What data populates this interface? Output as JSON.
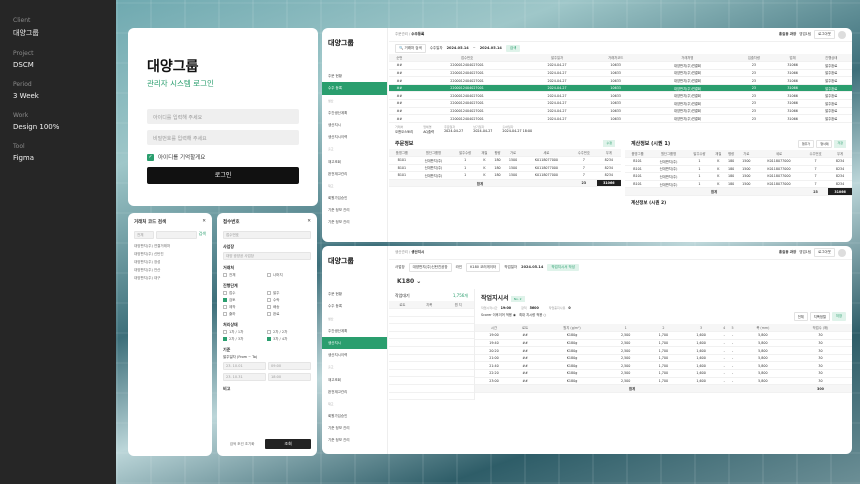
{
  "info": [
    {
      "k": "Client",
      "v": "대양그룹"
    },
    {
      "k": "Project",
      "v": "DSCM"
    },
    {
      "k": "Period",
      "v": "3 Week"
    },
    {
      "k": "Work",
      "v": "Design 100%"
    },
    {
      "k": "Tool",
      "v": "Figma"
    }
  ],
  "login": {
    "brand": "대양그룹",
    "subtitle": "관리자 시스템 로그인",
    "id_placeholder": "아이디를 입력해 주세요",
    "pw_placeholder": "비밀번호를 입력해 주세요",
    "remember": "아이디를 기억할게요",
    "login_button": "로그인"
  },
  "pop1": {
    "title": "거래처 코드 검색",
    "select": "전체",
    "search": "검색",
    "items": [
      "대양판지(주) 연결거래처",
      "대양판지(주) 신탄진",
      "대양판지(주) 장성",
      "대양판지(주) 안산",
      "대양판지(주) 대구"
    ]
  },
  "pop2": {
    "title": "접수번호",
    "f1": "접수번호",
    "lbl_site": "사업장",
    "site": "대양 광양공 사업장",
    "lbl_type": "거래처",
    "type1": "전체",
    "type2": "나머지",
    "lbl_status": "진행단계",
    "status": [
      "접수",
      "발주",
      "검토",
      "수락",
      "제작",
      "배송",
      "출하",
      "완료"
    ],
    "lbl_print": "처리상태",
    "print": [
      "1차 / 1차",
      "2차 / 2차",
      "2차 / 3차",
      "3차 / 4차"
    ],
    "lbl_date": "기준",
    "date_label": "발주일자 (From ~ To)",
    "d1": "23. 10.01",
    "t1": "09:00",
    "d2": "23. 10.31",
    "t2": "18:00",
    "lbl_memo": "비고",
    "reset": "검색 조건 초기화",
    "submit": "조회"
  },
  "app1": {
    "logo": "대양그룹",
    "menu": [
      "",
      "주문 현황",
      "수주 등록",
      "생산",
      "주간생산계획",
      "생산지시",
      "생산지시이력",
      "출고",
      "재고조회",
      "완전재고관리",
      "재고",
      "회원가입승인",
      "기준 정보 관리",
      "기준 정보 관리"
    ],
    "crumb_root": "주문관리",
    "crumb_cur": "수주등록",
    "user": "홍길동 과장",
    "dept": "영업1팀",
    "logout": "로그아웃",
    "filter_ph": "거래처 검색",
    "filter_label": "수주일자",
    "date_from": "2024.05.14",
    "date_to": "2024.05.14",
    "search": "검색",
    "headers": [
      "순번",
      "접수번호",
      "발주일자",
      "거래처코드",
      "거래처명",
      "입출차량",
      "업체",
      "진행상태"
    ],
    "rows": [
      [
        "##",
        "2200012404027001",
        "2024-04-27",
        "10633",
        "대양판지(주)연결회",
        "23",
        "31066",
        "발주완료"
      ],
      [
        "##",
        "2200012404027001",
        "2024-04-27",
        "10633",
        "대양판지(주)연결회",
        "23",
        "31066",
        "발주완료"
      ],
      [
        "##",
        "2200012404027001",
        "2024-04-27",
        "10633",
        "대양판지(주)연결회",
        "23",
        "31066",
        "발주완료"
      ],
      [
        "##",
        "2200012404027001",
        "2024-04-27",
        "10633",
        "대양판지(주)연결회",
        "23",
        "31066",
        "발주완료"
      ],
      [
        "##",
        "2200012404027001",
        "2024-04-27",
        "10633",
        "대양판지(주)연결회",
        "23",
        "31066",
        "발주완료"
      ],
      [
        "##",
        "2200012404027001",
        "2024-04-27",
        "10633",
        "대양판지(주)연결회",
        "23",
        "31066",
        "발주완료"
      ],
      [
        "##",
        "2200012404027001",
        "2024-04-27",
        "10633",
        "대양판지(주)연결회",
        "23",
        "31066",
        "발주완료"
      ],
      [
        "##",
        "2200012404027001",
        "2024-04-27",
        "10633",
        "대양판지(주)연결회",
        "23",
        "31066",
        "발주완료"
      ]
    ],
    "info": [
      {
        "k": "거래처",
        "v": "오앤오스토리"
      },
      {
        "k": "업체명",
        "v": "AQ출력"
      },
      {
        "k": "주문일자",
        "v": "2024-04-27"
      },
      {
        "k": "납기일자",
        "v": "2024-04-27"
      },
      {
        "k": "출하일자",
        "v": "2024-04-27 18:00"
      }
    ],
    "order_title": "주문정보",
    "order_tag": "수정",
    "calc_title": "계산정보 (시퀀 1)",
    "calc_title2": "계산정보 (시퀀 2)",
    "order_headers": [
      "품명그룹",
      "원단그룹명",
      "발주수량",
      "재질",
      "평량",
      "가로",
      "세로",
      "수주번호",
      "무게",
      "수주"
    ],
    "order_rows": [
      [
        "B101",
        "신대판지(주)",
        "1",
        "K",
        "180",
        "1500",
        "K0118077000",
        "7",
        "8234"
      ],
      [
        "B101",
        "신대판지(주)",
        "1",
        "K",
        "180",
        "1500",
        "K0118077000",
        "7",
        "8234"
      ],
      [
        "B101",
        "신대판지(주)",
        "1",
        "K",
        "180",
        "1500",
        "K0118077000",
        "7",
        "8234"
      ]
    ],
    "order_total": [
      "합계",
      "23",
      "31066"
    ],
    "calc_headers": [
      "품명그룹",
      "원단그룹명",
      "발주수량",
      "재질",
      "평량",
      "가로",
      "세로",
      "수주번호",
      "무게",
      "수주"
    ],
    "calc_rows": [
      [
        "B101",
        "신대판지(주)",
        "1",
        "K",
        "180",
        "1500",
        "K0118077000",
        "7",
        "8234"
      ],
      [
        "B101",
        "신대판지(주)",
        "1",
        "K",
        "180",
        "1500",
        "K0118077000",
        "7",
        "8234"
      ],
      [
        "B101",
        "신대판지(주)",
        "1",
        "K",
        "180",
        "1500",
        "K0118077000",
        "7",
        "8234"
      ],
      [
        "B101",
        "신대판지(주)",
        "1",
        "K",
        "180",
        "1500",
        "K0118077000",
        "7",
        "8234"
      ]
    ],
    "calc_total": [
      "합계",
      "23",
      "31066"
    ],
    "calc_btns": [
      "행추가",
      "행삭제",
      "저장"
    ]
  },
  "app2": {
    "logo": "대양그룹",
    "menu": [
      "",
      "주문 현황",
      "수주 등록",
      "생산",
      "주간생산계획",
      "생산지시",
      "생산지시이력",
      "출고",
      "재고조회",
      "완전재고관리",
      "재고",
      "회원가입승인",
      "기준 정보 관리",
      "기준 정보 관리"
    ],
    "crumb_root": "생산관리",
    "crumb_cur": "생산지시",
    "user": "홍길동 과장",
    "dept": "영업1팀",
    "logout": "로그아웃",
    "site_label": "사업장",
    "site": "대양판지(주)신탄진공장",
    "line_label": "라인",
    "line": "K180 코러게이터",
    "date_label": "작업일자",
    "date": "2024.05.14",
    "btn": "작업지시서 작성",
    "machine": "K180",
    "left_title": "작업대기",
    "left_count": "1,756개",
    "left_headers": [
      "로트",
      "지폭",
      "원 지"
    ],
    "right_title": "작업지시서",
    "right_tag": "No. 2",
    "meta": [
      {
        "k": "작업시작시간",
        "v": "19:00"
      },
      {
        "k": "장척",
        "v": "5600"
      },
      {
        "k": "작업중지사유",
        "v": "0"
      }
    ],
    "toggle1": "Scorer 이후이어 적용",
    "toggle2": "최대 지시량 적용",
    "r_btns": [
      "전체",
      "지폭정렬",
      "저장"
    ],
    "right_headers": [
      "시간",
      "로트",
      "원지 (g/m²)",
      "1",
      "2",
      "3",
      "4",
      "5",
      "폭 (mm)",
      "작업수 (매)"
    ],
    "right_rows": [
      [
        "19:00",
        "##",
        "K180g",
        "2,500",
        "1,700",
        "1,600",
        "-",
        "-",
        "5,800",
        "30"
      ],
      [
        "19:40",
        "##",
        "K180g",
        "2,500",
        "1,700",
        "1,600",
        "-",
        "-",
        "5,800",
        "30"
      ],
      [
        "20:20",
        "##",
        "K180g",
        "2,500",
        "1,700",
        "1,600",
        "-",
        "-",
        "5,800",
        "30"
      ],
      [
        "21:00",
        "##",
        "K180g",
        "2,500",
        "1,700",
        "1,600",
        "-",
        "-",
        "5,800",
        "30"
      ],
      [
        "21:40",
        "##",
        "K180g",
        "2,500",
        "1,700",
        "1,600",
        "-",
        "-",
        "5,800",
        "30"
      ],
      [
        "22:20",
        "##",
        "K180g",
        "2,500",
        "1,700",
        "1,600",
        "-",
        "-",
        "5,800",
        "30"
      ],
      [
        "23:00",
        "##",
        "K180g",
        "2,500",
        "1,700",
        "1,600",
        "-",
        "-",
        "5,800",
        "30"
      ]
    ],
    "right_total": [
      "합계",
      "300"
    ]
  }
}
